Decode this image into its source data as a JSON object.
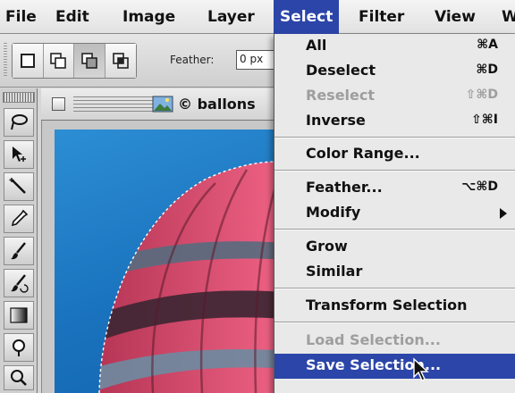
{
  "menubar": {
    "items": [
      "File",
      "Edit",
      "Image",
      "Layer",
      "Select",
      "Filter",
      "View",
      "W"
    ],
    "active": "Select"
  },
  "options_bar": {
    "selection_mode_icons": [
      "new-selection-icon",
      "add-to-selection-icon",
      "subtract-from-selection-icon",
      "intersect-selection-icon"
    ],
    "active_mode": "subtract-from-selection-icon",
    "feather_label": "Feather:",
    "feather_value": "0 px"
  },
  "document": {
    "title": "ballons",
    "close_icon": "close-box-icon",
    "file_icon": "image-file-icon"
  },
  "toolbox": {
    "tools": [
      "lasso-icon",
      "move-icon",
      "magic-wand-icon",
      "eyedropper-icon",
      "brush-icon",
      "history-brush-icon",
      "gradient-icon",
      "dodge-icon"
    ]
  },
  "select_menu": {
    "items": [
      {
        "label": "All",
        "shortcut": "⌘A",
        "enabled": true
      },
      {
        "label": "Deselect",
        "shortcut": "⌘D",
        "enabled": true
      },
      {
        "label": "Reselect",
        "shortcut": "⇧⌘D",
        "enabled": false
      },
      {
        "label": "Inverse",
        "shortcut": "⇧⌘I",
        "enabled": true
      },
      {
        "label": "Color Range...",
        "shortcut": "",
        "enabled": true
      },
      {
        "label": "Feather...",
        "shortcut": "⌥⌘D",
        "enabled": true
      },
      {
        "label": "Modify",
        "shortcut": "",
        "enabled": true,
        "submenu": true
      },
      {
        "label": "Grow",
        "shortcut": "",
        "enabled": true
      },
      {
        "label": "Similar",
        "shortcut": "",
        "enabled": true
      },
      {
        "label": "Transform Selection",
        "shortcut": "",
        "enabled": true
      },
      {
        "label": "Load Selection...",
        "shortcut": "",
        "enabled": false
      },
      {
        "label": "Save Selection...",
        "shortcut": "",
        "enabled": true,
        "highlighted": true
      }
    ]
  },
  "colors": {
    "menu_highlight": "#2b45a8",
    "sky": "#1a73be",
    "balloon_red": "#e84a6e",
    "balloon_dark": "#4a2a38"
  }
}
